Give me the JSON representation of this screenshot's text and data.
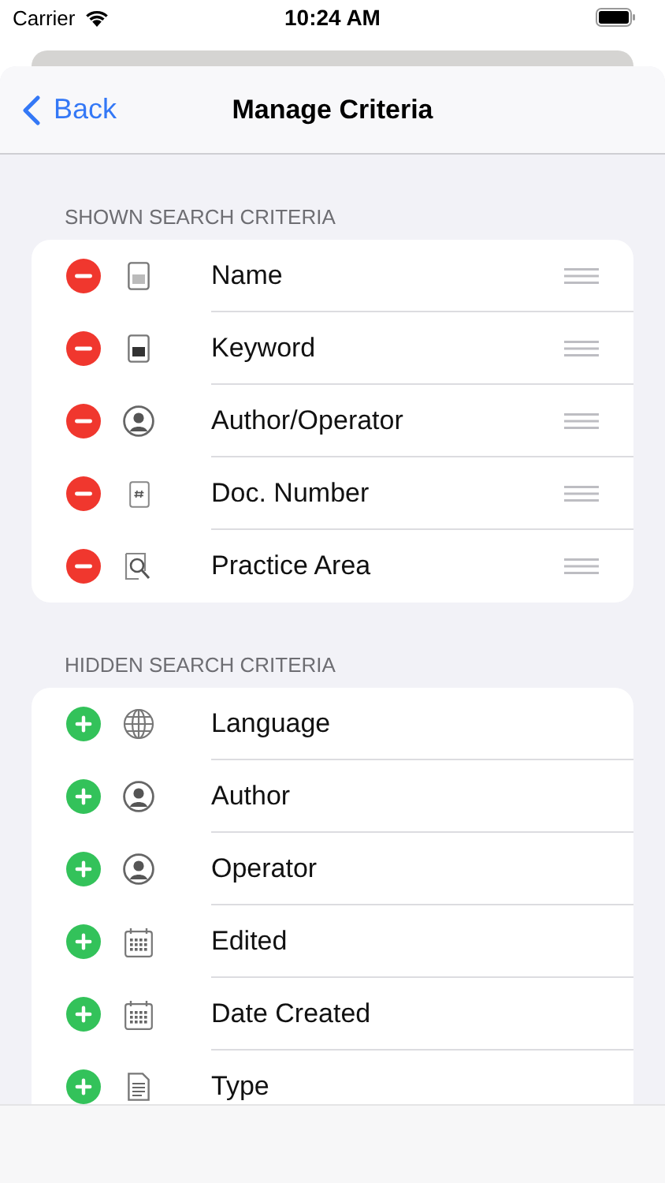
{
  "status_bar": {
    "carrier": "Carrier",
    "time": "10:24 AM"
  },
  "nav": {
    "back": "Back",
    "title": "Manage Criteria"
  },
  "sections": [
    {
      "header": "SHOWN SEARCH CRITERIA",
      "kind": "remove",
      "reorderable": true,
      "items": [
        {
          "label": "Name",
          "kind": "document"
        },
        {
          "label": "Keyword",
          "kind": "document-filled"
        },
        {
          "label": "Author/Operator",
          "kind": "person"
        },
        {
          "label": "Doc. Number",
          "kind": "document-hash"
        },
        {
          "label": "Practice Area",
          "kind": "document-search"
        }
      ]
    },
    {
      "header": "HIDDEN SEARCH CRITERIA",
      "kind": "add",
      "reorderable": false,
      "items": [
        {
          "label": "Language",
          "kind": "globe"
        },
        {
          "label": "Author",
          "kind": "person"
        },
        {
          "label": "Operator",
          "kind": "person"
        },
        {
          "label": "Edited",
          "kind": "calendar"
        },
        {
          "label": "Date Created",
          "kind": "calendar"
        },
        {
          "label": "Type",
          "kind": "document-lines"
        }
      ]
    }
  ]
}
